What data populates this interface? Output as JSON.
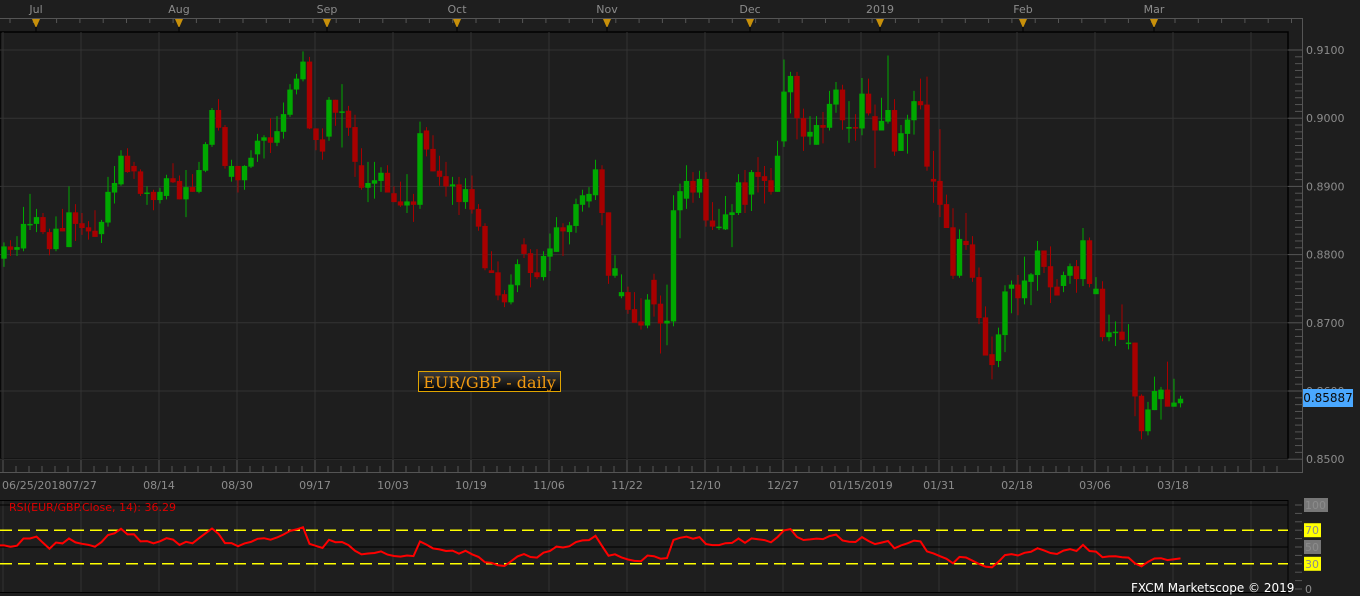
{
  "chart_data": {
    "type": "candlestick",
    "title": "EUR/GBP - daily",
    "instrument": "EUR/GBP",
    "timeframe": "daily",
    "current_price": "0.85887",
    "y_axis": {
      "ylim": [
        0.85,
        0.91
      ],
      "tick_labels": [
        "0.9100",
        "0.9000",
        "0.8900",
        "0.8800",
        "0.8700",
        "0.8600",
        "0.8500"
      ]
    },
    "x_axis": {
      "tick_labels": [
        "06/25/2018",
        "07/27",
        "08/14",
        "08/30",
        "09/17",
        "10/03",
        "10/19",
        "11/06",
        "11/22",
        "12/10",
        "12/27",
        "01/15/2019",
        "01/31",
        "02/18",
        "03/06",
        "03/18"
      ],
      "month_markers": [
        "Jul",
        "Aug",
        "Sep",
        "Oct",
        "Nov",
        "Dec",
        "2019",
        "Feb",
        "Mar"
      ]
    },
    "grid": true,
    "colors": {
      "up": "#00a800",
      "down": "#a80000",
      "background": "#1e1e1e",
      "grid": "#333333",
      "rsi_line": "#ff0000",
      "rsi_levels": "#ffff00",
      "price_tag": "#4aa8ff",
      "marker": "#c8900a"
    },
    "ohlc_fields": [
      "open",
      "high",
      "low",
      "close"
    ],
    "ohlc": [
      [
        0.8794,
        0.8818,
        0.8782,
        0.8812
      ],
      [
        0.8812,
        0.8821,
        0.8798,
        0.8807
      ],
      [
        0.8807,
        0.8827,
        0.8798,
        0.8811
      ],
      [
        0.8809,
        0.887,
        0.8805,
        0.8845
      ],
      [
        0.8844,
        0.8889,
        0.8836,
        0.8845
      ],
      [
        0.8845,
        0.8867,
        0.8833,
        0.8855
      ],
      [
        0.8855,
        0.8861,
        0.883,
        0.8833
      ],
      [
        0.8833,
        0.8838,
        0.8799,
        0.8808
      ],
      [
        0.8808,
        0.8856,
        0.8805,
        0.8838
      ],
      [
        0.8839,
        0.8867,
        0.8834,
        0.8834
      ],
      [
        0.8811,
        0.89,
        0.8811,
        0.8862
      ],
      [
        0.8862,
        0.8874,
        0.882,
        0.8845
      ],
      [
        0.8846,
        0.8861,
        0.8829,
        0.8839
      ],
      [
        0.884,
        0.8849,
        0.8822,
        0.8834
      ],
      [
        0.8835,
        0.8865,
        0.8826,
        0.8826
      ],
      [
        0.883,
        0.8851,
        0.8817,
        0.8848
      ],
      [
        0.8847,
        0.8914,
        0.8841,
        0.8892
      ],
      [
        0.8891,
        0.893,
        0.8875,
        0.8905
      ],
      [
        0.8903,
        0.8953,
        0.8901,
        0.8945
      ],
      [
        0.8945,
        0.8956,
        0.892,
        0.8921
      ],
      [
        0.893,
        0.8936,
        0.8911,
        0.8922
      ],
      [
        0.8922,
        0.8925,
        0.8886,
        0.8889
      ],
      [
        0.889,
        0.89,
        0.8873,
        0.8891
      ],
      [
        0.8892,
        0.8895,
        0.8865,
        0.888
      ],
      [
        0.888,
        0.8898,
        0.8875,
        0.8892
      ],
      [
        0.8886,
        0.8917,
        0.8881,
        0.8912
      ],
      [
        0.8912,
        0.8934,
        0.8905,
        0.8906
      ],
      [
        0.8908,
        0.8916,
        0.8881,
        0.8881
      ],
      [
        0.8881,
        0.8924,
        0.8855,
        0.8899
      ],
      [
        0.8899,
        0.8918,
        0.8892,
        0.8892
      ],
      [
        0.8892,
        0.8936,
        0.889,
        0.8924
      ],
      [
        0.8923,
        0.8965,
        0.8921,
        0.8962
      ],
      [
        0.8961,
        0.9015,
        0.8958,
        0.9012
      ],
      [
        0.9012,
        0.9028,
        0.8982,
        0.8986
      ],
      [
        0.8987,
        0.899,
        0.8926,
        0.893
      ],
      [
        0.8914,
        0.8939,
        0.8907,
        0.893
      ],
      [
        0.893,
        0.893,
        0.8891,
        0.8909
      ],
      [
        0.8909,
        0.8931,
        0.8895,
        0.893
      ],
      [
        0.8929,
        0.8953,
        0.8927,
        0.8942
      ],
      [
        0.8947,
        0.8977,
        0.8936,
        0.8967
      ],
      [
        0.8967,
        0.8975,
        0.8941,
        0.8972
      ],
      [
        0.8972,
        0.9,
        0.8949,
        0.8964
      ],
      [
        0.8964,
        0.9003,
        0.8959,
        0.8981
      ],
      [
        0.898,
        0.9023,
        0.897,
        0.9006
      ],
      [
        0.9005,
        0.905,
        0.9002,
        0.9042
      ],
      [
        0.9042,
        0.9065,
        0.9035,
        0.9058
      ],
      [
        0.9057,
        0.9098,
        0.9054,
        0.9083
      ],
      [
        0.9083,
        0.909,
        0.8984,
        0.8985
      ],
      [
        0.8985,
        0.8985,
        0.8953,
        0.8968
      ],
      [
        0.8969,
        0.8985,
        0.8939,
        0.8951
      ],
      [
        0.8973,
        0.9031,
        0.8967,
        0.9027
      ],
      [
        0.9027,
        0.9027,
        0.8989,
        0.9008
      ],
      [
        0.9009,
        0.905,
        0.8957,
        0.901
      ],
      [
        0.9011,
        0.9018,
        0.8974,
        0.8986
      ],
      [
        0.8987,
        0.9005,
        0.8914,
        0.8936
      ],
      [
        0.8931,
        0.8956,
        0.8895,
        0.8898
      ],
      [
        0.8898,
        0.8936,
        0.8877,
        0.8905
      ],
      [
        0.8904,
        0.8936,
        0.8882,
        0.8909
      ],
      [
        0.8908,
        0.8928,
        0.8892,
        0.892
      ],
      [
        0.892,
        0.8931,
        0.8891,
        0.8891
      ],
      [
        0.889,
        0.89,
        0.8877,
        0.8877
      ],
      [
        0.8878,
        0.8907,
        0.887,
        0.8872
      ],
      [
        0.8872,
        0.8918,
        0.8861,
        0.8878
      ],
      [
        0.8878,
        0.8889,
        0.8848,
        0.8873
      ],
      [
        0.8873,
        0.8995,
        0.8867,
        0.8978
      ],
      [
        0.8982,
        0.8987,
        0.8944,
        0.8954
      ],
      [
        0.8955,
        0.8975,
        0.8922,
        0.8922
      ],
      [
        0.8923,
        0.8945,
        0.8901,
        0.8914
      ],
      [
        0.8915,
        0.8936,
        0.8885,
        0.89
      ],
      [
        0.89,
        0.8914,
        0.8873,
        0.8903
      ],
      [
        0.8903,
        0.8914,
        0.8858,
        0.8877
      ],
      [
        0.8877,
        0.8912,
        0.8867,
        0.8896
      ],
      [
        0.8896,
        0.8916,
        0.886,
        0.8866
      ],
      [
        0.8867,
        0.8874,
        0.8835,
        0.8841
      ],
      [
        0.8842,
        0.8846,
        0.8777,
        0.878
      ],
      [
        0.8777,
        0.8805,
        0.8773,
        0.8773
      ],
      [
        0.8774,
        0.879,
        0.8733,
        0.874
      ],
      [
        0.8742,
        0.8748,
        0.8723,
        0.873
      ],
      [
        0.873,
        0.8771,
        0.8727,
        0.8756
      ],
      [
        0.8755,
        0.8793,
        0.8745,
        0.8786
      ],
      [
        0.8815,
        0.8824,
        0.8795,
        0.8801
      ],
      [
        0.8802,
        0.8808,
        0.8752,
        0.8773
      ],
      [
        0.8774,
        0.8808,
        0.8764,
        0.8767
      ],
      [
        0.8767,
        0.8805,
        0.8762,
        0.8798
      ],
      [
        0.8797,
        0.8831,
        0.8776,
        0.8809
      ],
      [
        0.8804,
        0.8855,
        0.8804,
        0.884
      ],
      [
        0.884,
        0.8846,
        0.8798,
        0.8834
      ],
      [
        0.8833,
        0.8848,
        0.8815,
        0.8843
      ],
      [
        0.8842,
        0.8882,
        0.8832,
        0.8874
      ],
      [
        0.8873,
        0.8895,
        0.8863,
        0.8887
      ],
      [
        0.8878,
        0.8899,
        0.8869,
        0.8889
      ],
      [
        0.8887,
        0.8939,
        0.888,
        0.8925
      ],
      [
        0.8925,
        0.8931,
        0.8843,
        0.8861
      ],
      [
        0.8862,
        0.8862,
        0.8757,
        0.8769
      ],
      [
        0.8769,
        0.8799,
        0.8766,
        0.878
      ],
      [
        0.8739,
        0.8771,
        0.8736,
        0.8745
      ],
      [
        0.8745,
        0.8753,
        0.8713,
        0.8719
      ],
      [
        0.872,
        0.8745,
        0.87,
        0.87
      ],
      [
        0.8702,
        0.8736,
        0.869,
        0.8696
      ],
      [
        0.8696,
        0.8742,
        0.8692,
        0.8734
      ],
      [
        0.8763,
        0.8772,
        0.8709,
        0.8727
      ],
      [
        0.8728,
        0.874,
        0.8655,
        0.8699
      ],
      [
        0.8699,
        0.8756,
        0.8667,
        0.8703
      ],
      [
        0.8702,
        0.8887,
        0.8695,
        0.8865
      ],
      [
        0.8865,
        0.8904,
        0.8824,
        0.8893
      ],
      [
        0.8882,
        0.8931,
        0.8867,
        0.8908
      ],
      [
        0.8908,
        0.8921,
        0.8876,
        0.8891
      ],
      [
        0.8891,
        0.8923,
        0.8883,
        0.8911
      ],
      [
        0.8911,
        0.8921,
        0.8841,
        0.885
      ],
      [
        0.885,
        0.8877,
        0.8836,
        0.8841
      ],
      [
        0.8839,
        0.8867,
        0.8836,
        0.8841
      ],
      [
        0.8837,
        0.8886,
        0.8836,
        0.8859
      ],
      [
        0.8858,
        0.8874,
        0.8811,
        0.8862
      ],
      [
        0.8861,
        0.8918,
        0.8858,
        0.8906
      ],
      [
        0.8906,
        0.8924,
        0.8861,
        0.8873
      ],
      [
        0.8888,
        0.8924,
        0.8864,
        0.8921
      ],
      [
        0.8921,
        0.8943,
        0.8891,
        0.8914
      ],
      [
        0.8915,
        0.893,
        0.8875,
        0.8908
      ],
      [
        0.8909,
        0.8927,
        0.8888,
        0.8892
      ],
      [
        0.8892,
        0.8967,
        0.8892,
        0.8945
      ],
      [
        0.8966,
        0.9086,
        0.8958,
        0.9039
      ],
      [
        0.9038,
        0.9068,
        0.9007,
        0.9062
      ],
      [
        0.9062,
        0.9068,
        0.8969,
        0.9
      ],
      [
        0.9,
        0.9014,
        0.8952,
        0.8973
      ],
      [
        0.8973,
        0.9003,
        0.8961,
        0.898
      ],
      [
        0.8961,
        0.9003,
        0.8961,
        0.899
      ],
      [
        0.899,
        0.9009,
        0.8963,
        0.8986
      ],
      [
        0.8986,
        0.904,
        0.8982,
        0.9021
      ],
      [
        0.902,
        0.9053,
        0.9008,
        0.9042
      ],
      [
        0.9042,
        0.9049,
        0.8983,
        0.8997
      ],
      [
        0.8985,
        0.9025,
        0.8964,
        0.8987
      ],
      [
        0.8987,
        0.9006,
        0.8967,
        0.8985
      ],
      [
        0.8985,
        0.9059,
        0.8975,
        0.9036
      ],
      [
        0.9036,
        0.9058,
        0.9004,
        0.9007
      ],
      [
        0.9003,
        0.902,
        0.8927,
        0.8982
      ],
      [
        0.8982,
        0.903,
        0.8982,
        0.8996
      ],
      [
        0.8995,
        0.9092,
        0.8992,
        0.9012
      ],
      [
        0.9012,
        0.9028,
        0.8945,
        0.8951
      ],
      [
        0.8952,
        0.899,
        0.8952,
        0.8978
      ],
      [
        0.8977,
        0.9005,
        0.8948,
        0.8998
      ],
      [
        0.8997,
        0.904,
        0.8976,
        0.9025
      ],
      [
        0.9025,
        0.9058,
        0.9013,
        0.9019
      ],
      [
        0.902,
        0.9061,
        0.8923,
        0.8929
      ],
      [
        0.8911,
        0.8952,
        0.8876,
        0.8907
      ],
      [
        0.8908,
        0.8984,
        0.8855,
        0.8873
      ],
      [
        0.8874,
        0.8888,
        0.8839,
        0.8839
      ],
      [
        0.884,
        0.8868,
        0.8764,
        0.8769
      ],
      [
        0.8769,
        0.8837,
        0.8766,
        0.8823
      ],
      [
        0.882,
        0.8861,
        0.8807,
        0.8814
      ],
      [
        0.8815,
        0.8827,
        0.876,
        0.8766
      ],
      [
        0.8767,
        0.8781,
        0.8698,
        0.8707
      ],
      [
        0.8708,
        0.8724,
        0.8652,
        0.8652
      ],
      [
        0.8654,
        0.868,
        0.8617,
        0.8638
      ],
      [
        0.8644,
        0.8693,
        0.8635,
        0.8683
      ],
      [
        0.8682,
        0.8755,
        0.8657,
        0.8746
      ],
      [
        0.875,
        0.8762,
        0.8714,
        0.8756
      ],
      [
        0.8756,
        0.877,
        0.8711,
        0.8736
      ],
      [
        0.8736,
        0.8797,
        0.8727,
        0.8762
      ],
      [
        0.876,
        0.8773,
        0.8726,
        0.8771
      ],
      [
        0.877,
        0.882,
        0.8747,
        0.8806
      ],
      [
        0.8806,
        0.8806,
        0.8773,
        0.8782
      ],
      [
        0.8783,
        0.8812,
        0.8729,
        0.8752
      ],
      [
        0.8753,
        0.8764,
        0.874,
        0.874
      ],
      [
        0.8754,
        0.8775,
        0.8745,
        0.877
      ],
      [
        0.8769,
        0.8787,
        0.8757,
        0.8783
      ],
      [
        0.8783,
        0.8792,
        0.8744,
        0.8764
      ],
      [
        0.8764,
        0.8839,
        0.8754,
        0.8821
      ],
      [
        0.8821,
        0.8825,
        0.8752,
        0.8757
      ],
      [
        0.8742,
        0.8767,
        0.8742,
        0.875
      ],
      [
        0.875,
        0.8761,
        0.8673,
        0.8679
      ],
      [
        0.8679,
        0.8712,
        0.8673,
        0.8686
      ],
      [
        0.8685,
        0.8702,
        0.8666,
        0.8687
      ],
      [
        0.8687,
        0.8727,
        0.8675,
        0.8675
      ],
      [
        0.8669,
        0.8698,
        0.8661,
        0.8671
      ],
      [
        0.8671,
        0.8671,
        0.8563,
        0.8592
      ],
      [
        0.8593,
        0.8595,
        0.8529,
        0.8541
      ],
      [
        0.8541,
        0.8584,
        0.8535,
        0.8573
      ],
      [
        0.8572,
        0.8621,
        0.8572,
        0.86
      ],
      [
        0.8588,
        0.8606,
        0.8558,
        0.8602
      ],
      [
        0.8602,
        0.8643,
        0.8577,
        0.8577
      ],
      [
        0.8577,
        0.8618,
        0.8577,
        0.8583
      ],
      [
        0.8582,
        0.8593,
        0.8576,
        0.85887
      ]
    ],
    "rsi": {
      "label": "RSI(EUR/GBP.Close, 14): 36.29",
      "period": 14,
      "last_value": 36.29,
      "ylim": [
        0,
        100
      ],
      "levels": [
        30,
        70
      ],
      "axis_labels": [
        "100",
        "70",
        "50",
        "30",
        "0"
      ]
    }
  },
  "watermark": "FXCM Marketscope © 2019"
}
